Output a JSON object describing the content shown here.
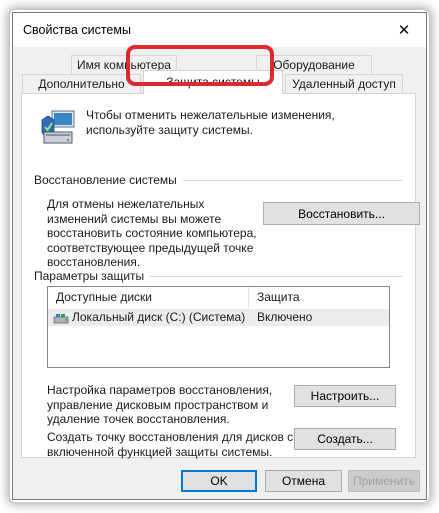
{
  "window": {
    "title": "Свойства системы",
    "close_symbol": "✕"
  },
  "tabs": {
    "back_row": [
      "Имя компьютера",
      "Оборудование"
    ],
    "front_row": [
      "Дополнительно",
      "Защита системы",
      "Удаленный доступ"
    ],
    "active": "Защита системы"
  },
  "header": {
    "description": "Чтобы отменить нежелательные изменения, используйте защиту системы."
  },
  "restore": {
    "group_title": "Восстановление системы",
    "description": "Для отмены нежелательных изменений системы вы можете восстановить состояние компьютера, соответствующее предыдущей точке восстановления.",
    "button": "Восстановить..."
  },
  "protection": {
    "group_title": "Параметры защиты",
    "columns": [
      "Доступные диски",
      "Защита"
    ],
    "rows": [
      {
        "drive": "Локальный диск (C:) (Система)",
        "status": "Включено"
      }
    ],
    "configure_text": "Настройка параметров восстановления, управление дисковым пространством и удаление точек восстановления.",
    "configure_button": "Настроить...",
    "create_text": "Создать точку восстановления для дисков с включенной функцией защиты системы.",
    "create_button": "Создать..."
  },
  "footer": {
    "ok": "OK",
    "cancel": "Отмена",
    "apply": "Применить"
  },
  "colors": {
    "highlight": "#e0272f",
    "ok_border": "#0078d7"
  }
}
